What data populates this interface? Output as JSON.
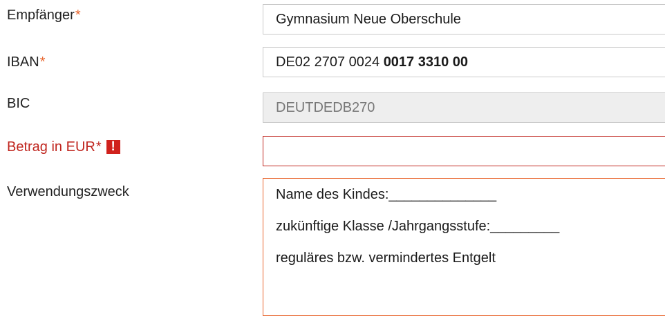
{
  "form": {
    "recipient": {
      "label": "Empfänger",
      "required_mark": "*",
      "value": "Gymnasium Neue Oberschule"
    },
    "iban": {
      "label": "IBAN",
      "required_mark": "*",
      "value_plain": "DE02 2707 0024 ",
      "value_bold": "0017 3310 00"
    },
    "bic": {
      "label": "BIC",
      "value": "DEUTDEDB270"
    },
    "amount": {
      "label": "Betrag in EUR",
      "required_mark": "*",
      "error_icon": "!",
      "value": ""
    },
    "purpose": {
      "label": "Verwendungszweck",
      "lines": [
        "Name des Kindes:______________",
        "zukünftige Klasse /Jahrgangsstufe:_________",
        "reguläres bzw. vermindertes Entgelt"
      ]
    }
  },
  "colors": {
    "required_star": "#e8632a",
    "error": "#c0261f",
    "error_badge": "#d0211c",
    "readonly_bg": "#eeeeee",
    "textarea_focus_border": "#e8632a"
  }
}
